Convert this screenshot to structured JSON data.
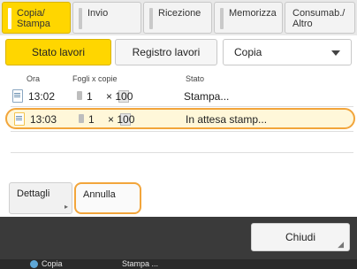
{
  "tabs": [
    {
      "label": "Copia/\nStampa",
      "active": true
    },
    {
      "label": "Invio"
    },
    {
      "label": "Ricezione"
    },
    {
      "label": "Memorizza"
    },
    {
      "label": "Consumab./\nAltro"
    }
  ],
  "segments": {
    "stato": "Stato lavori",
    "registro": "Registro lavori",
    "select_value": "Copia"
  },
  "table": {
    "headers": [
      "Ora",
      "Fogli x copie",
      "Stato"
    ],
    "rows": [
      {
        "time": "13:02",
        "pages": "1",
        "copies": "× 100",
        "status": "Stampa..."
      },
      {
        "time": "13:03",
        "pages": "1",
        "copies": "× 100",
        "status": "In attesa stamp..."
      }
    ]
  },
  "actions": {
    "dettagli": "Dettagli",
    "annulla": "Annulla",
    "chiudi": "Chiudi"
  },
  "status_bar": {
    "left": "Copia",
    "middle": "Stampa ..."
  },
  "colors": {
    "accent": "#ffd600",
    "highlight": "#f2a53b"
  }
}
